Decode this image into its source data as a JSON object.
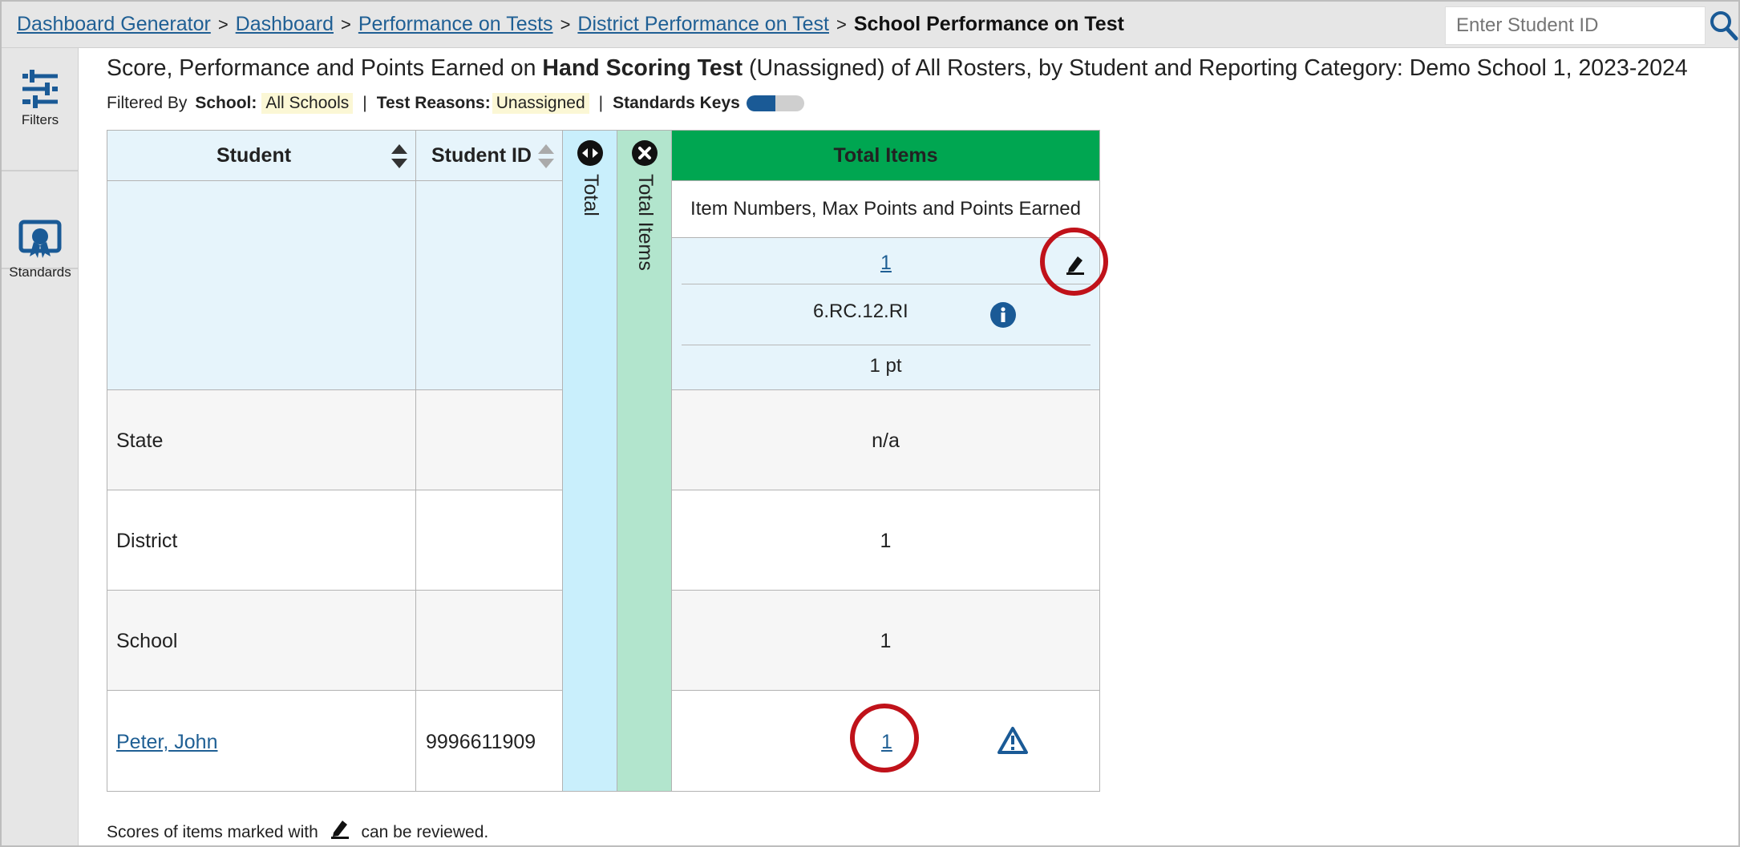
{
  "breadcrumb": {
    "items": [
      "Dashboard Generator",
      "Dashboard",
      "Performance on Tests",
      "District Performance on Test"
    ],
    "current": "School Performance on Test",
    "separator": ">"
  },
  "search": {
    "placeholder": "Enter Student ID"
  },
  "sidebar": {
    "items": [
      {
        "label": "Filters",
        "icon": "filters-sliders-icon"
      },
      {
        "label": "Standards",
        "icon": "standards-ribbon-icon"
      }
    ]
  },
  "report": {
    "title_prefix": "Score, Performance and Points Earned on ",
    "test_name": "Hand Scoring Test",
    "title_suffix": " (Unassigned) of All Rosters, by Student and Reporting Category: Demo School 1, 2023-2024",
    "filtered_by_label": "Filtered By",
    "school_label": "School:",
    "school_value": "All Schools",
    "test_reasons_label": "Test Reasons:",
    "test_reasons_value": "Unassigned",
    "standards_keys_label": "Standards Keys",
    "pipe": "|"
  },
  "table": {
    "col_student": "Student",
    "col_student_id": "Student ID",
    "col_total": "Total",
    "col_total_items": "Total Items",
    "group_header": "Total Items",
    "subheader": "Item Numbers, Max Points and Points Earned",
    "item_number": "1",
    "item_standard": "6.RC.12.RI",
    "item_max_points": "1 pt",
    "rows": [
      {
        "student": "State",
        "student_id": "",
        "value": "n/a"
      },
      {
        "student": "District",
        "student_id": "",
        "value": "1"
      },
      {
        "student": "School",
        "student_id": "",
        "value": "1"
      },
      {
        "student": "Peter, John",
        "student_id": "9996611909",
        "value": "1"
      }
    ]
  },
  "footnote": {
    "before": "Scores of items marked with",
    "after": "can be reviewed."
  },
  "colors": {
    "link": "#1f5f94",
    "total_column": "#c9effc",
    "total_items_column": "#b2e5cd",
    "group_header": "#00a651",
    "header_bg": "#e6f4fb",
    "row_bg": "#f6f6f6",
    "highlight_circle": "#c0121a",
    "icon_blue": "#1a5a96"
  }
}
